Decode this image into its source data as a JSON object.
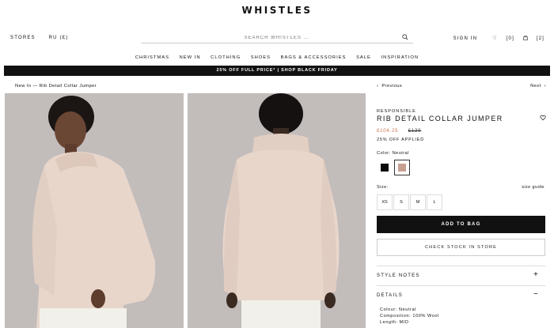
{
  "brand": "WHISTLES",
  "header": {
    "stores": "STORES",
    "locale": "RU (£)",
    "search_placeholder": "SEARCH WHISTLES ...",
    "sign_in": "SIGN IN",
    "wishlist_count": "[0]",
    "bag_count": "[2]"
  },
  "nav": [
    "CHRISTMAS",
    "NEW IN",
    "CLOTHING",
    "SHOES",
    "BAGS & ACCESSORIES",
    "SALE",
    "INSPIRATION"
  ],
  "promo": "25% OFF FULL PRICE* | SHOP BLACK FRIDAY",
  "breadcrumb": "New In — Rib Detail Collar Jumper",
  "pager": {
    "prev": "Previous",
    "next": "Next"
  },
  "product": {
    "tag": "RESPONSIBLE",
    "name": "RIB DETAIL COLLAR JUMPER",
    "sale_price": "£104.25",
    "original_price": "£139",
    "discount_note": "25% OFF APPLIED",
    "color_label": "Color: Neutral",
    "swatches": [
      {
        "name": "Black",
        "color": "#0a0a0a"
      },
      {
        "name": "Neutral",
        "color": "#c9a090"
      }
    ],
    "size_label": "Size:",
    "size_guide": "size guide",
    "sizes": [
      "XS",
      "S",
      "M",
      "L"
    ],
    "add_to_bag": "ADD TO BAG",
    "check_stock": "CHECK STOCK IN STORE",
    "style_notes": "STYLE NOTES",
    "details_title": "DETAILS",
    "details": {
      "colour": "Colour: Neutral",
      "composition": "Composition: 100% Wool",
      "length": "Length: MID"
    }
  },
  "colors": {
    "accent_price": "#c9704a",
    "photo_bg": "#c2bcbb",
    "jumper": "#e8d6cb"
  }
}
